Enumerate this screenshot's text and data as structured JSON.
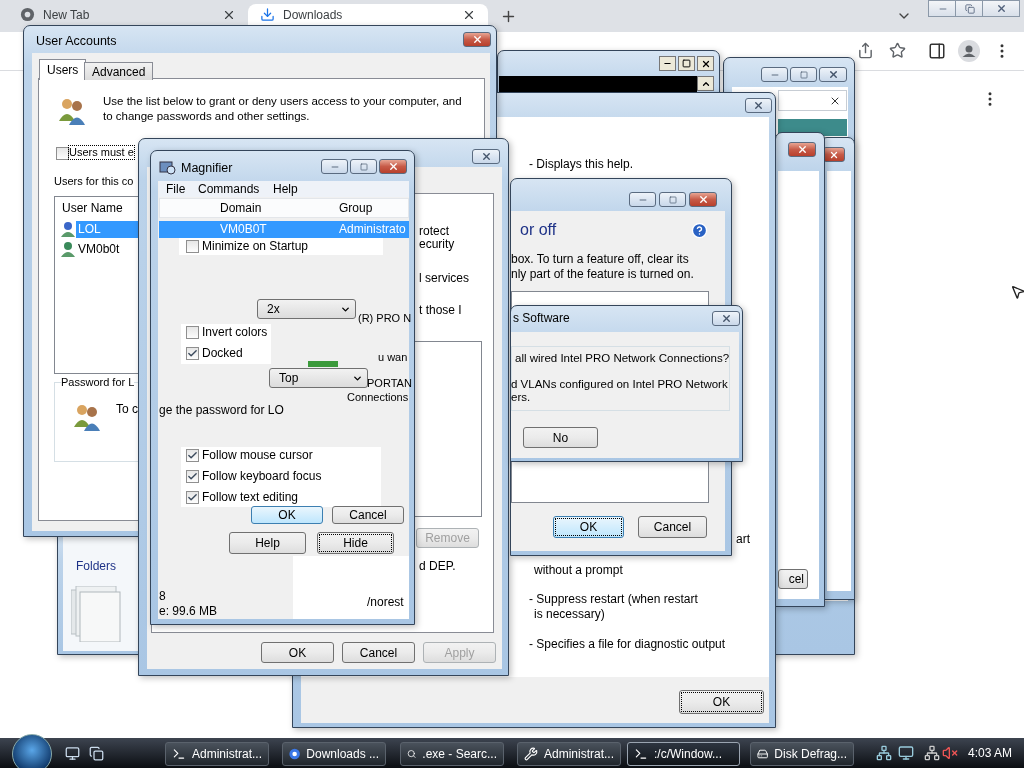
{
  "browser": {
    "tabs": [
      {
        "label": "New Tab",
        "selected": false
      },
      {
        "label": "Downloads",
        "selected": true
      }
    ]
  },
  "right_window": {
    "button": "cel"
  },
  "help_window": {
    "lines": [
      "- Displays this help.",
      "art",
      "without a prompt",
      "- Suppress restart (when restart",
      "is necessary)",
      "- Specifies a file for diagnostic output"
    ],
    "ok": "OK"
  },
  "explorer": {
    "folders": "Folders"
  },
  "user_accounts": {
    "title": "User Accounts",
    "tabs": [
      {
        "label": "Users",
        "selected": true
      },
      {
        "label": "Advanced",
        "selected": false
      }
    ],
    "intro": "Use the list below to grant or deny users access to your computer, and to change passwords and other settings.",
    "must_enter": {
      "label": "Users must e",
      "checked": false
    },
    "users_label": "Users for this co",
    "list_header": "User Name",
    "users": [
      {
        "name": "LOL",
        "selected": true
      },
      {
        "name": "VM0b0t",
        "selected": false
      }
    ],
    "password_group": "Password for L",
    "password_text": "To c"
  },
  "properties": {
    "fragments": [
      "rotect",
      "ecurity",
      "l services",
      "t those I",
      "d DEP."
    ],
    "remove": {
      "label": "Remove",
      "disabled": true
    },
    "buttons": [
      {
        "label": "OK",
        "disabled": false
      },
      {
        "label": "Cancel",
        "disabled": false
      },
      {
        "label": "Apply",
        "disabled": true
      }
    ]
  },
  "features": {
    "heading": "or off",
    "description": [
      "box. To turn a feature off, clear its",
      "nly part of the feature is turned on."
    ],
    "buttons": [
      {
        "label": "OK",
        "default": true
      },
      {
        "label": "Cancel",
        "default": false
      }
    ]
  },
  "intel_dialog": {
    "title": "s Software",
    "question": "all wired Intel PRO Network Connections?",
    "note": [
      "d VLANs configured on Intel PRO Network",
      "ers."
    ],
    "no_button": "No"
  },
  "magnifier": {
    "title": "Magnifier",
    "menu": [
      "File",
      "Commands",
      "Help"
    ],
    "columns": [
      "Domain",
      "Group"
    ],
    "row": [
      "VM0B0T",
      "Administrato"
    ],
    "options": [
      {
        "label": "Minimize on Startup",
        "checked": false
      },
      {
        "label": "Invert colors",
        "checked": false
      },
      {
        "label": "Docked",
        "checked": true
      },
      {
        "label": "Follow mouse cursor",
        "checked": true
      },
      {
        "label": "Follow keyboard focus",
        "checked": true
      },
      {
        "label": "Follow text editing",
        "checked": true
      }
    ],
    "scale": "2x",
    "position": "Top",
    "ghost_text": [
      "(R) PRO N",
      "u wan",
      "PORTAN",
      "Connections",
      "ge the password for LO",
      "8",
      "e: 99.6 MB",
      "/norest"
    ],
    "buttons": [
      {
        "label": "OK",
        "default": true,
        "focused": false
      },
      {
        "label": "Cancel",
        "default": false,
        "focused": false
      },
      {
        "label": "Help",
        "default": false,
        "focused": false
      },
      {
        "label": "Hide",
        "default": false,
        "focused": true
      }
    ]
  },
  "taskbar": {
    "items": [
      {
        "label": "Administrat...",
        "kind": "console",
        "active": false
      },
      {
        "label": "Downloads ...",
        "kind": "browser",
        "active": false
      },
      {
        "label": ".exe - Searc...",
        "kind": "search",
        "active": false
      },
      {
        "label": "Administrat...",
        "kind": "tools",
        "active": false
      },
      {
        "label": ":/c/Window...",
        "kind": "console",
        "active": true
      },
      {
        "label": "Disk Defrag...",
        "kind": "disk",
        "active": false
      }
    ],
    "clock": "4:03 AM"
  }
}
